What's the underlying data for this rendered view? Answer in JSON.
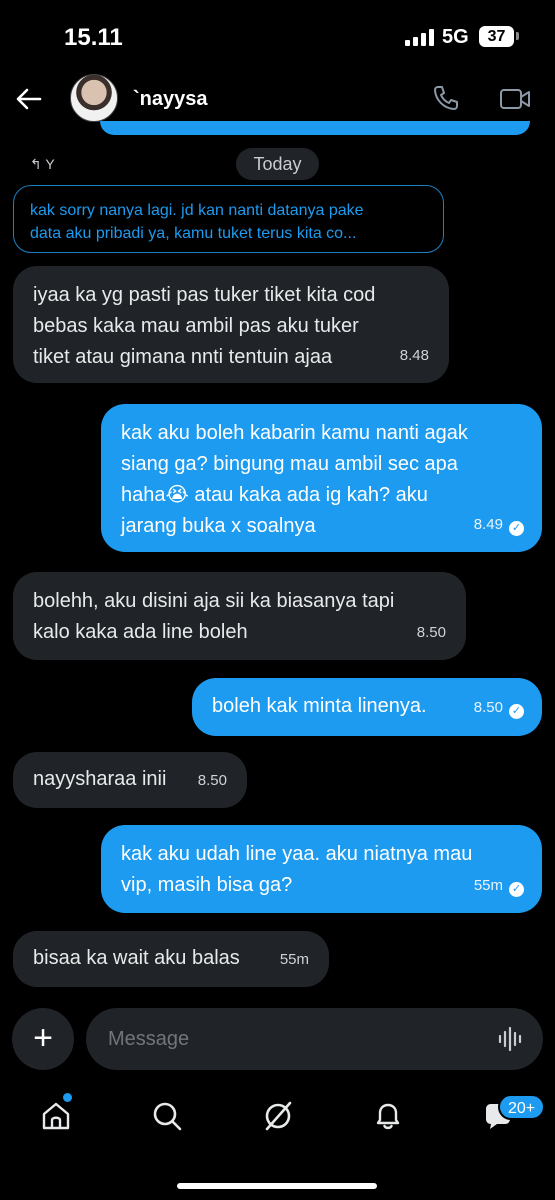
{
  "status_bar": {
    "time": "15.11",
    "network": "5G",
    "battery": "37",
    "battery_level": 0.37
  },
  "header": {
    "contact_name": "`nayysa"
  },
  "reply": {
    "indicator": "↰ Y",
    "quoted_line1": "kak sorry nanya lagi. jd kan nanti datanya pake",
    "quoted_line2": "data aku pribadi ya, kamu tuket terus kita co..."
  },
  "date_separator": "Today",
  "messages": [
    {
      "direction": "in",
      "lines": [
        "iyaa ka yg pasti pas tuker tiket kita cod",
        "bebas kaka mau ambil pas aku tuker",
        "tiket atau gimana nnti tentuin ajaa"
      ],
      "time": "8.48"
    },
    {
      "direction": "out",
      "lines": [
        "kak aku boleh kabarin kamu nanti agak",
        "siang ga? bingung mau ambil sec apa",
        "haha😭 atau kaka ada ig kah? aku",
        "jarang buka x soalnya"
      ],
      "time": "8.49",
      "read": true
    },
    {
      "direction": "in",
      "lines": [
        "bolehh, aku disini aja sii ka biasanya tapi",
        "kalo kaka ada line boleh"
      ],
      "time": "8.50"
    },
    {
      "direction": "out",
      "lines": [
        "boleh kak minta linenya."
      ],
      "time": "8.50",
      "read": true
    },
    {
      "direction": "in",
      "lines": [
        "nayysharaa inii"
      ],
      "time": "8.50"
    },
    {
      "direction": "out",
      "lines": [
        "kak aku udah line yaa. aku niatnya mau",
        "vip, masih bisa ga?"
      ],
      "time": "55m",
      "read": true
    },
    {
      "direction": "in",
      "lines": [
        "bisaa ka wait aku balas"
      ],
      "time": "55m"
    }
  ],
  "composer": {
    "placeholder": "Message"
  },
  "bottom_nav": {
    "items": [
      "home-icon",
      "search-icon",
      "grok-icon",
      "notifications-icon",
      "messages-icon"
    ],
    "badge": "20+"
  },
  "colors": {
    "accent": "#1d9bf0",
    "incoming_bubble": "#202327",
    "background": "#000000"
  }
}
